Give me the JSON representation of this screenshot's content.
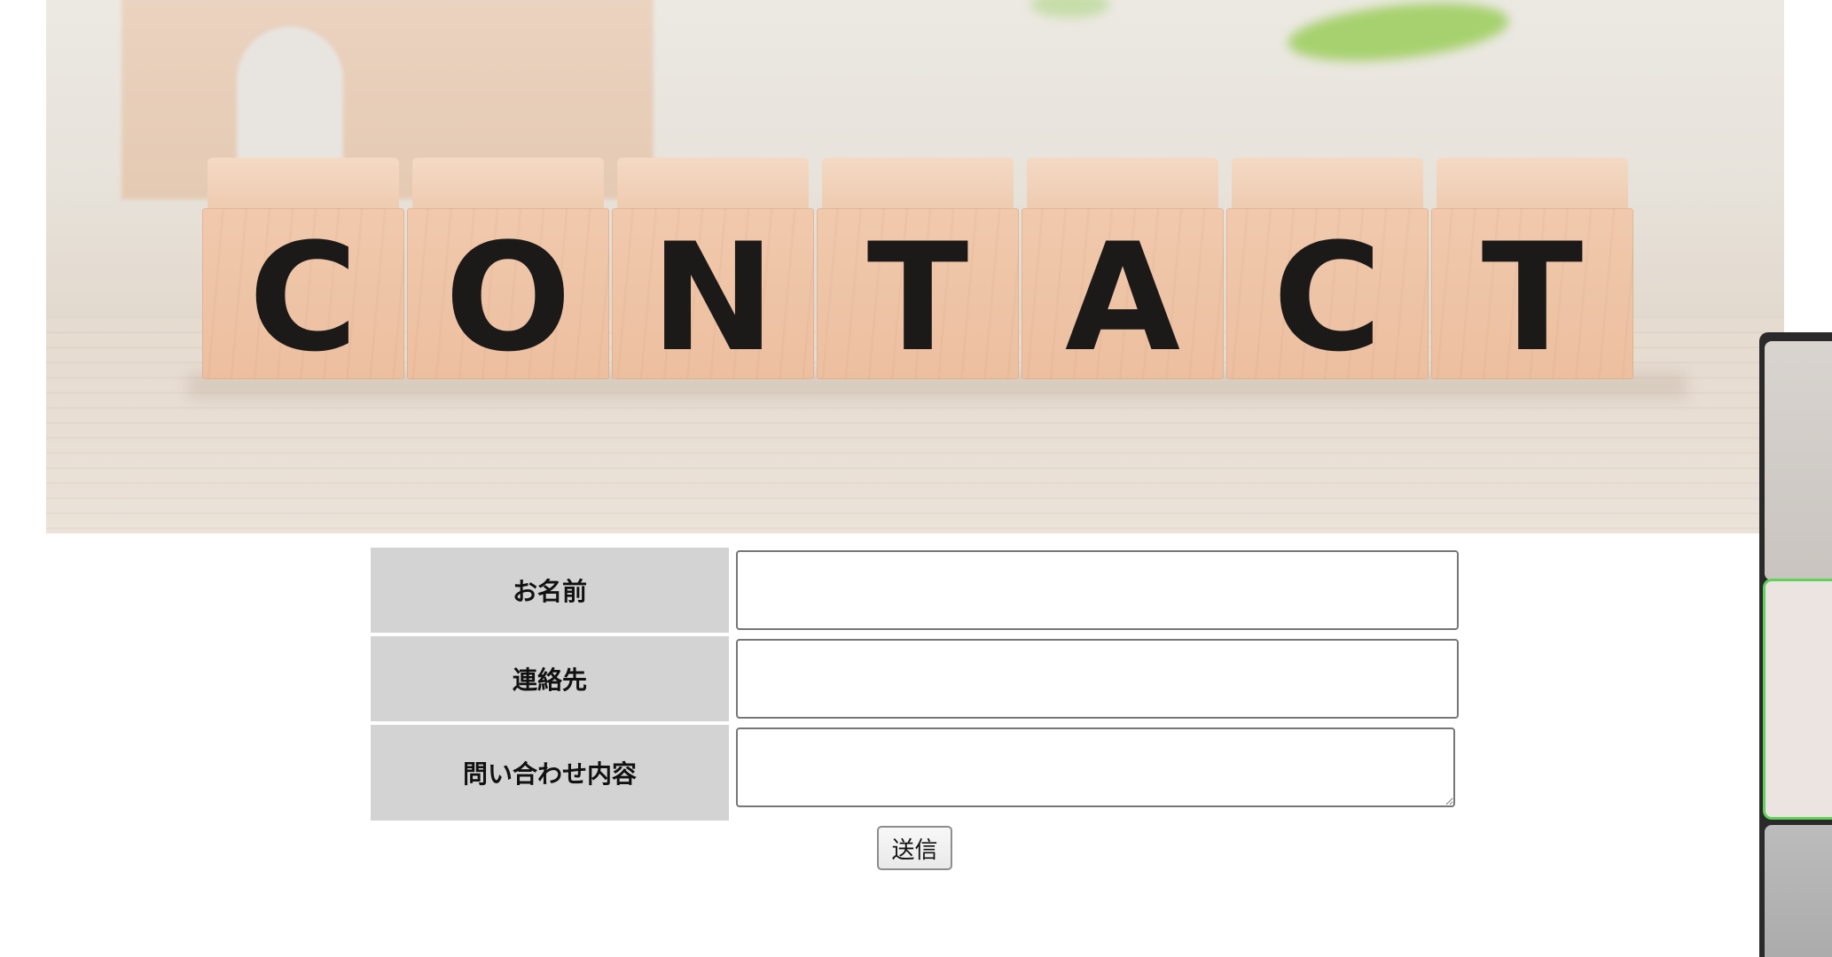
{
  "hero": {
    "letters": [
      "C",
      "O",
      "N",
      "T",
      "A",
      "C",
      "T"
    ]
  },
  "form": {
    "name_label": "お名前",
    "name_value": "",
    "contact_label": "連絡先",
    "contact_value": "",
    "inquiry_label": "問い合わせ内容",
    "inquiry_value": "",
    "submit_label": "送信"
  },
  "colors": {
    "label_background": "#d3d3d3",
    "selected_thumbnail_border": "#5fd25a"
  }
}
